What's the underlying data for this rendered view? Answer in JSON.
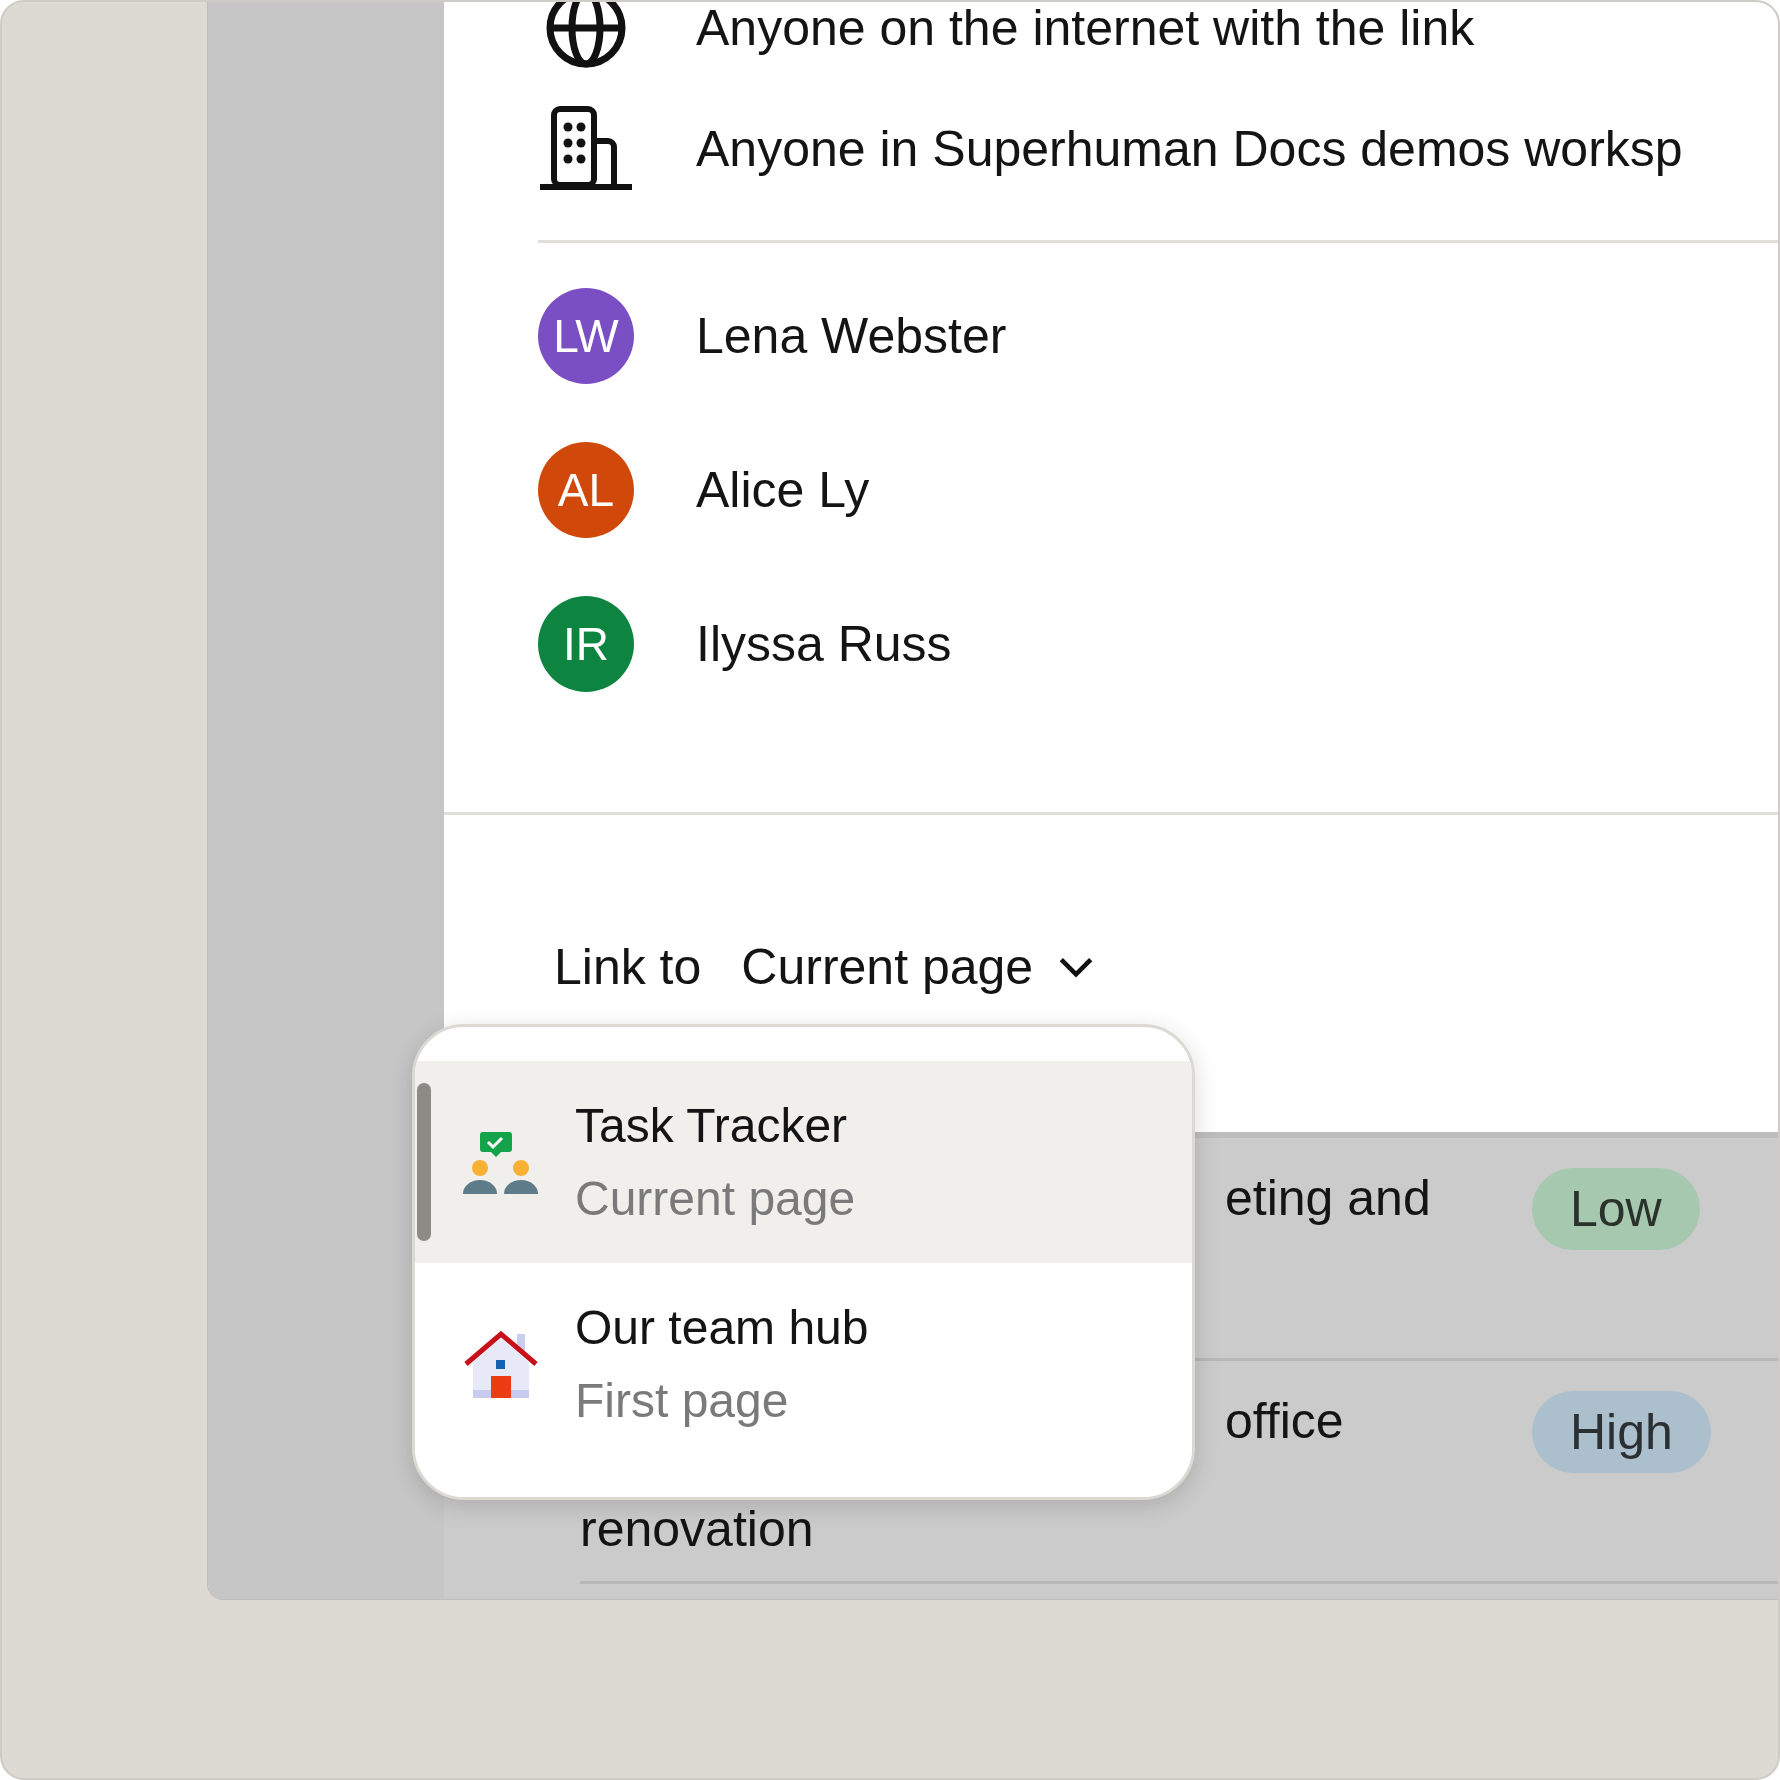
{
  "access_options": [
    {
      "kind": "globe",
      "label": "Anyone on the internet with the link"
    },
    {
      "kind": "building",
      "label": "Anyone in Superhuman Docs demos worksp"
    }
  ],
  "people": [
    {
      "initials": "LW",
      "name": "Lena Webster",
      "color": "#7b4fc4"
    },
    {
      "initials": "AL",
      "name": "Alice Ly",
      "color": "#d1480b"
    },
    {
      "initials": "IR",
      "name": "Ilyssa Russ",
      "color": "#0d8440"
    }
  ],
  "link_to": {
    "label": "Link to",
    "value": "Current page"
  },
  "dropdown": {
    "items": [
      {
        "kind": "team",
        "title": "Task Tracker",
        "subtitle": "Current page",
        "selected": true
      },
      {
        "kind": "house",
        "title": "Our team hub",
        "subtitle": "First page",
        "selected": false
      }
    ]
  },
  "table": {
    "rows": [
      {
        "lines": [
          "eting and"
        ],
        "priority": {
          "label": "Low",
          "color": "#a6c8ae"
        }
      },
      {
        "lines": [
          "office",
          "renovation"
        ],
        "priority": {
          "label": "High",
          "color": "#abc0cc"
        }
      }
    ]
  }
}
